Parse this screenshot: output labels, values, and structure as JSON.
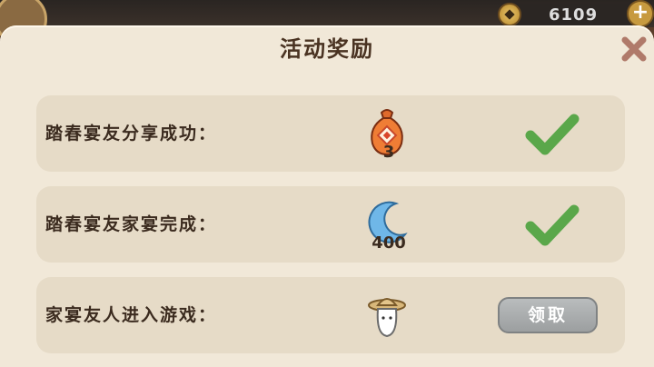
{
  "hud": {
    "currency_amount": "6109",
    "currency_icon": "coin-icon",
    "add_icon": "plus-icon"
  },
  "dialog": {
    "title": "活动奖励",
    "close_icon": "close-icon",
    "rows": [
      {
        "label": "踏春宴友分享成功：",
        "reward_icon": "lucky-bag-icon",
        "reward_count": "3",
        "status": "completed",
        "status_icon": "check-icon"
      },
      {
        "label": "踏春宴友家宴完成：",
        "reward_icon": "crescent-moon-icon",
        "reward_count": "400",
        "status": "completed",
        "status_icon": "check-icon"
      },
      {
        "label": "家宴友人进入游戏：",
        "reward_icon": "straw-hat-character-icon",
        "reward_count": "",
        "status": "claimable",
        "claim_label": "领取"
      }
    ]
  },
  "colors": {
    "panel_bg": "#f1e8d8",
    "row_bg": "#e6dbc7",
    "check_green": "#5aa74a",
    "close_red": "#b07a6a",
    "claim_gray": "#a9acad"
  }
}
